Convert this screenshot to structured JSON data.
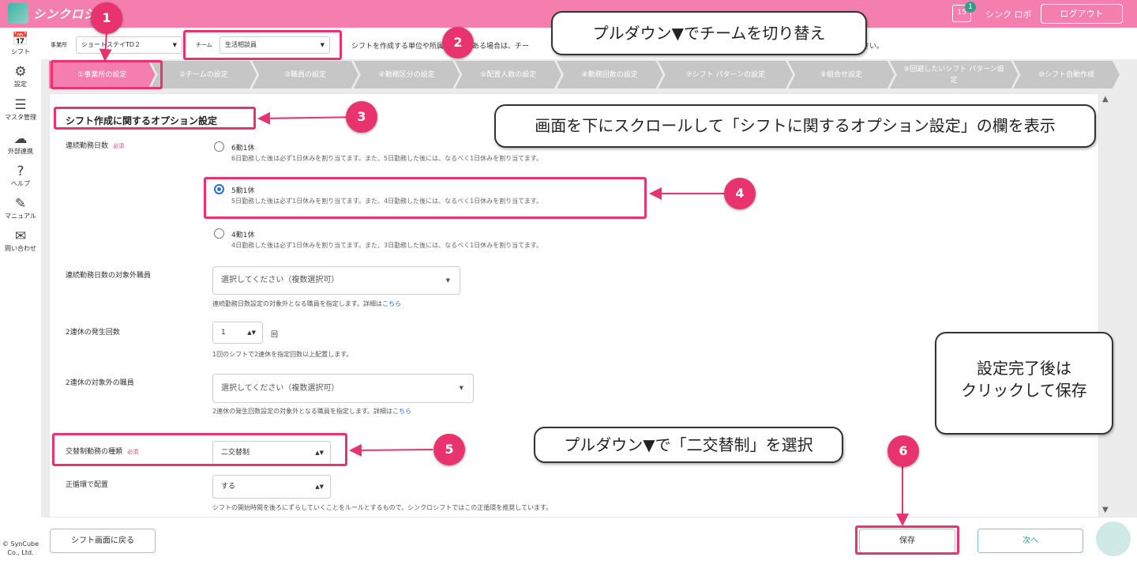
{
  "app": {
    "logo_text": "シンクロシフト",
    "notification_count": "1",
    "calendar_day": "15",
    "user_name": "シンク ロボ",
    "logout_label": "ログアウト"
  },
  "sidebar": {
    "items": [
      {
        "label": "シフト",
        "icon": "calendar-icon"
      },
      {
        "label": "設定",
        "icon": "gear-icon"
      },
      {
        "label": "マスタ管理",
        "icon": "database-icon"
      },
      {
        "label": "外部連携",
        "icon": "cloud-icon"
      },
      {
        "label": "ヘルプ",
        "icon": "help-icon"
      },
      {
        "label": "マニュアル",
        "icon": "edit-icon"
      },
      {
        "label": "問い合わせ",
        "icon": "mail-icon"
      }
    ],
    "copyright": "© SynCube Co., Ltd."
  },
  "filters": {
    "office_label": "事業所",
    "office_value": "ショートステイTD２",
    "team_label": "チーム",
    "team_value": "生活相談員",
    "info_left": "シフトを作成する単位や所属に変更がある場合は、チー",
    "info_right": "さい。"
  },
  "steps": [
    "①事業所の設定",
    "②チームの設定",
    "③職員の設定",
    "④勤務区分の設定",
    "⑤配置人数の設定",
    "⑥勤務回数の設定",
    "⑦シフト パターンの設定",
    "⑧組合せ設定",
    "⑨回避したいシフト パターン設定",
    "⑩シフト自動作成"
  ],
  "section": {
    "title": "シフト作成に関するオプション設定"
  },
  "consecutive": {
    "label": "連続勤務日数",
    "required": "必須",
    "options": [
      {
        "title": "6勤1休",
        "desc": "6日勤務した後は必ず1日休みを割り当てます。また、5日勤務した後には、なるべく1日休みを割り当てます。",
        "selected": false
      },
      {
        "title": "5勤1休",
        "desc": "5日勤務した後は必ず1日休みを割り当てます。また、4日勤務した後には、なるべく1日休みを割り当てます。",
        "selected": true
      },
      {
        "title": "4勤1休",
        "desc": "4日勤務した後は必ず1日休みを割り当てます。また、3日勤務した後には、なるべく1日休みを割り当てます。",
        "selected": false
      }
    ]
  },
  "excluded_staff": {
    "label": "連続勤務日数の対象外職員",
    "placeholder": "選択してください（複数選択可）",
    "help": "連続勤務日数設定の対象外となる職員を指定します。詳細は",
    "link": "こちら"
  },
  "two_day_off": {
    "label": "2連休の発生回数",
    "value": "1",
    "unit": "回",
    "help": "1回のシフトで2連休を指定回数以上配置します。"
  },
  "two_day_excluded": {
    "label": "2連休の対象外の職員",
    "placeholder": "選択してください（複数選択可）",
    "help": "2連休の発生回数設定の対象外となる職員を指定します。詳細は",
    "link": "こちら"
  },
  "shift_type": {
    "label": "交替制勤務の種類",
    "required": "必須",
    "value": "二交替制"
  },
  "rotation": {
    "label": "正循環で配置",
    "value": "する",
    "help": "シフトの開始時間を後ろにずらしていくことをルールとするもので、シンクロシフトではこの正循環を推奨しています。"
  },
  "footer": {
    "back_label": "シフト画面に戻る",
    "save_label": "保存",
    "next_label": "次へ"
  },
  "annotations": {
    "numbers": [
      "1",
      "2",
      "3",
      "4",
      "5",
      "6"
    ],
    "callout2": "プルダウン▼でチームを切り替え",
    "callout3": "画面を下にスクロールして「シフトに関するオプション設定」の欄を表示",
    "callout5": "プルダウン▼で「二交替制」を選択",
    "callout6_line1": "設定完了後は",
    "callout6_line2": "クリックして保存"
  },
  "colors": {
    "brand_pink": "#f47fae",
    "highlight": "#e8336f",
    "teal": "#2e9d8a",
    "link_blue": "#2a6fd6",
    "step_inactive": "#c6c6c6"
  }
}
